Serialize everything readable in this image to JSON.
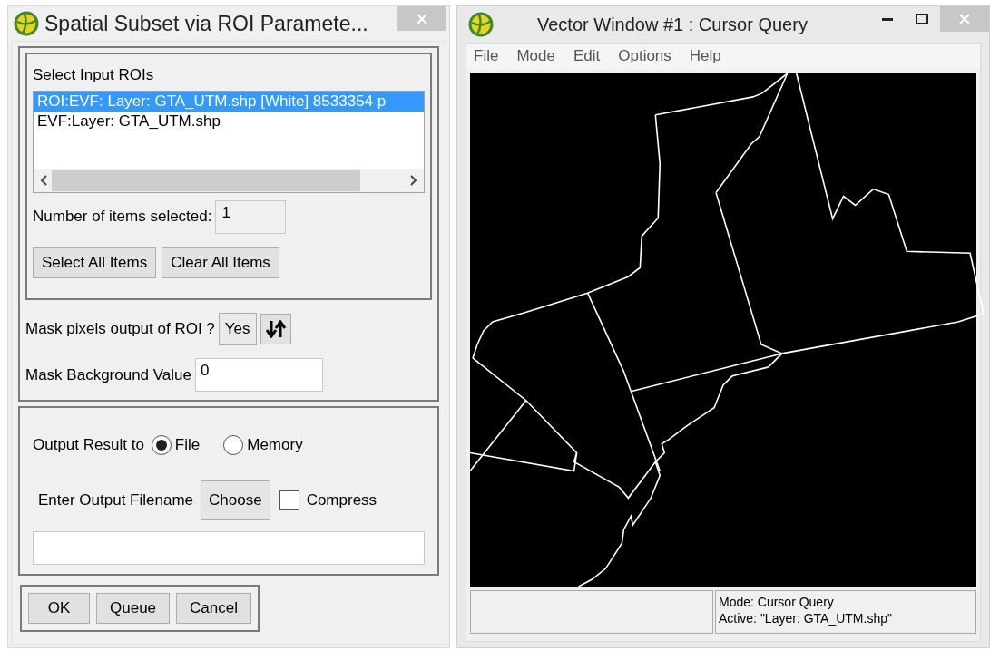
{
  "dialog": {
    "title": "Spatial Subset via ROI Paramete...",
    "roi_list": {
      "label": "Select Input ROIs",
      "items": [
        {
          "text": "ROI:EVF: Layer: GTA_UTM.shp [White] 8533354 p",
          "selected": true
        },
        {
          "text": "EVF:Layer: GTA_UTM.shp",
          "selected": false
        }
      ]
    },
    "selected_count": {
      "label": "Number of items selected:",
      "value": "1"
    },
    "selection_buttons": [
      "Select All Items",
      "Clear All Items"
    ],
    "mask": {
      "label": "Mask pixels output of ROI ?",
      "value": "Yes"
    },
    "background": {
      "label": "Mask Background Value",
      "value": "0"
    },
    "output": {
      "label": "Output Result to",
      "options": [
        {
          "label": "File",
          "selected": true
        },
        {
          "label": "Memory",
          "selected": false
        }
      ]
    },
    "filename": {
      "label": "Enter Output Filename",
      "button": "Choose",
      "compress": {
        "label": "Compress",
        "checked": false
      }
    },
    "actions": [
      "OK",
      "Queue",
      "Cancel"
    ]
  },
  "vector_window": {
    "title": "Vector Window #1 : Cursor Query",
    "menu": [
      "File",
      "Mode",
      "Edit",
      "Options",
      "Help"
    ],
    "status": [
      "Mode: Cursor Query",
      "Active: \"Layer: GTA_UTM.shp\""
    ]
  }
}
